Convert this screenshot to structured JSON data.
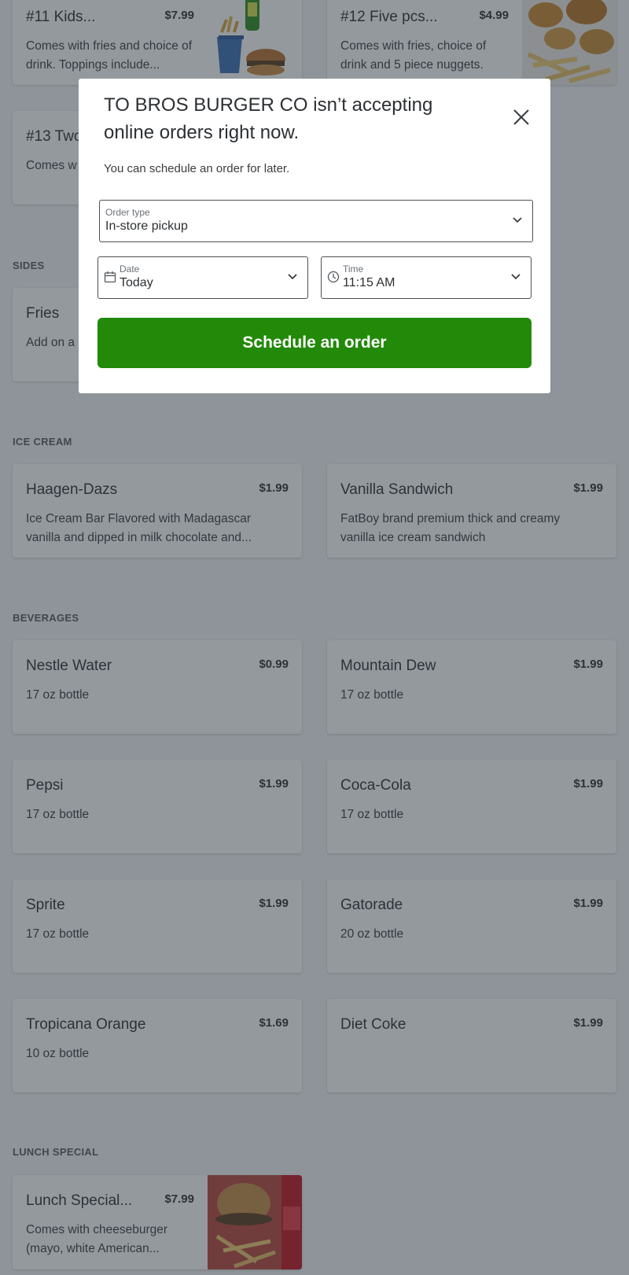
{
  "sections": {
    "sides": "SIDES",
    "ice_cream": "ICE CREAM",
    "beverages": "BEVERAGES",
    "lunch_special": "LUNCH SPECIAL"
  },
  "items": {
    "kids": {
      "name": "#11 Kids...",
      "price": "$7.99",
      "desc": "Comes with fries and choice of drink. Toppings include..."
    },
    "five_pcs": {
      "name": "#12 Five pcs...",
      "price": "$4.99",
      "desc": "Comes with fries, choice of drink and 5 piece nuggets."
    },
    "two": {
      "name": "#13 Two",
      "desc": "Comes w drink, and"
    },
    "fries": {
      "name": "Fries",
      "desc": "Add on a Click to m"
    },
    "haagen": {
      "name": "Haagen-Dazs",
      "price": "$1.99",
      "desc": "Ice Cream Bar Flavored with Madagascar vanilla and dipped in milk chocolate and..."
    },
    "vanilla": {
      "name": "Vanilla Sandwich",
      "price": "$1.99",
      "desc": "FatBoy brand premium thick and creamy vanilla ice cream sandwich"
    },
    "nestle": {
      "name": "Nestle Water",
      "price": "$0.99",
      "desc": "17 oz bottle"
    },
    "mdew": {
      "name": "Mountain Dew",
      "price": "$1.99",
      "desc": "17 oz bottle"
    },
    "pepsi": {
      "name": "Pepsi",
      "price": "$1.99",
      "desc": "17 oz bottle"
    },
    "coke": {
      "name": "Coca-Cola",
      "price": "$1.99",
      "desc": "17 oz bottle"
    },
    "sprite": {
      "name": "Sprite",
      "price": "$1.99",
      "desc": "17 oz bottle"
    },
    "gatorade": {
      "name": "Gatorade",
      "price": "$1.99",
      "desc": "20 oz bottle"
    },
    "tropicana": {
      "name": "Tropicana Orange",
      "price": "$1.69",
      "desc": "10 oz bottle"
    },
    "dietcoke": {
      "name": "Diet Coke",
      "price": "$1.99",
      "desc": ""
    },
    "lunch": {
      "name": "Lunch Special...",
      "price": "$7.99",
      "desc": "Comes with cheeseburger (mayo, white American..."
    }
  },
  "modal": {
    "title": "TO BROS BURGER CO isn’t accepting online orders right now.",
    "subtitle": "You can schedule an order for later.",
    "order_type_label": "Order type",
    "order_type_value": "In-store pickup",
    "date_label": "Date",
    "date_value": "Today",
    "time_label": "Time",
    "time_value": "11:15 AM",
    "button": "Schedule an order"
  },
  "icons": {
    "close": "close-icon",
    "chevron": "chevron-down-icon",
    "calendar": "calendar-icon",
    "clock": "clock-icon"
  },
  "colors": {
    "primary_button": "#228909",
    "overlay": "rgba(42,52,62,0.5)"
  }
}
